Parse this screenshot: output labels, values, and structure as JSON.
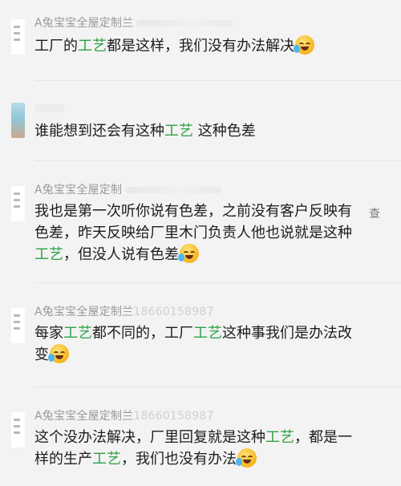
{
  "comments": [
    {
      "sender": "A兔宝宝全屋定制兰",
      "sender_blurred": true,
      "avatar": "logo-avatar",
      "segments": [
        {
          "t": "工厂的"
        },
        {
          "t": "工艺",
          "hl": true
        },
        {
          "t": "都是这样，我们没有办法解决"
        }
      ],
      "emoji": "laugh-cry-emoji"
    },
    {
      "sender": "",
      "sender_blurred": true,
      "avatar": "photo-avatar",
      "segments": [
        {
          "t": "谁能想到还会有这种"
        },
        {
          "t": "工艺",
          "hl": true
        },
        {
          "t": " 这种色差"
        }
      ],
      "emoji": ""
    },
    {
      "sender": "A兔宝宝全屋定制",
      "sender_blurred": true,
      "avatar": "logo-avatar",
      "side_link": "查",
      "segments": [
        {
          "t": "我也是第一次听你说有色差，之前没有客户反映有色差，昨天反映给厂里木门负责人他也说就是这种"
        },
        {
          "t": "工艺",
          "hl": true
        },
        {
          "t": "，但没人说有色差"
        }
      ],
      "emoji": "laugh-cry-emoji"
    },
    {
      "sender": "A兔宝宝全屋定制兰",
      "sender_blurred": true,
      "sender_phone": "18660158987",
      "avatar": "logo-avatar",
      "segments": [
        {
          "t": "每家"
        },
        {
          "t": "工艺",
          "hl": true
        },
        {
          "t": "都不同的，工厂"
        },
        {
          "t": "工艺",
          "hl": true
        },
        {
          "t": "这种事我们是办法改变"
        }
      ],
      "emoji": "laugh-cry-emoji"
    },
    {
      "sender": "A兔宝宝全屋定制兰",
      "sender_blurred": true,
      "sender_phone": "18660158987",
      "avatar": "logo-avatar",
      "segments": [
        {
          "t": "这个没办法解决，厂里回复就是这种"
        },
        {
          "t": "工艺",
          "hl": true
        },
        {
          "t": "，都是一样的生产"
        },
        {
          "t": "工艺",
          "hl": true
        },
        {
          "t": "，我们也没有办法"
        }
      ],
      "emoji": "laugh-cry-emoji"
    }
  ],
  "colors": {
    "highlight": "#2fa046",
    "sender": "#9a9a9a",
    "background": "#f3f3f3"
  }
}
